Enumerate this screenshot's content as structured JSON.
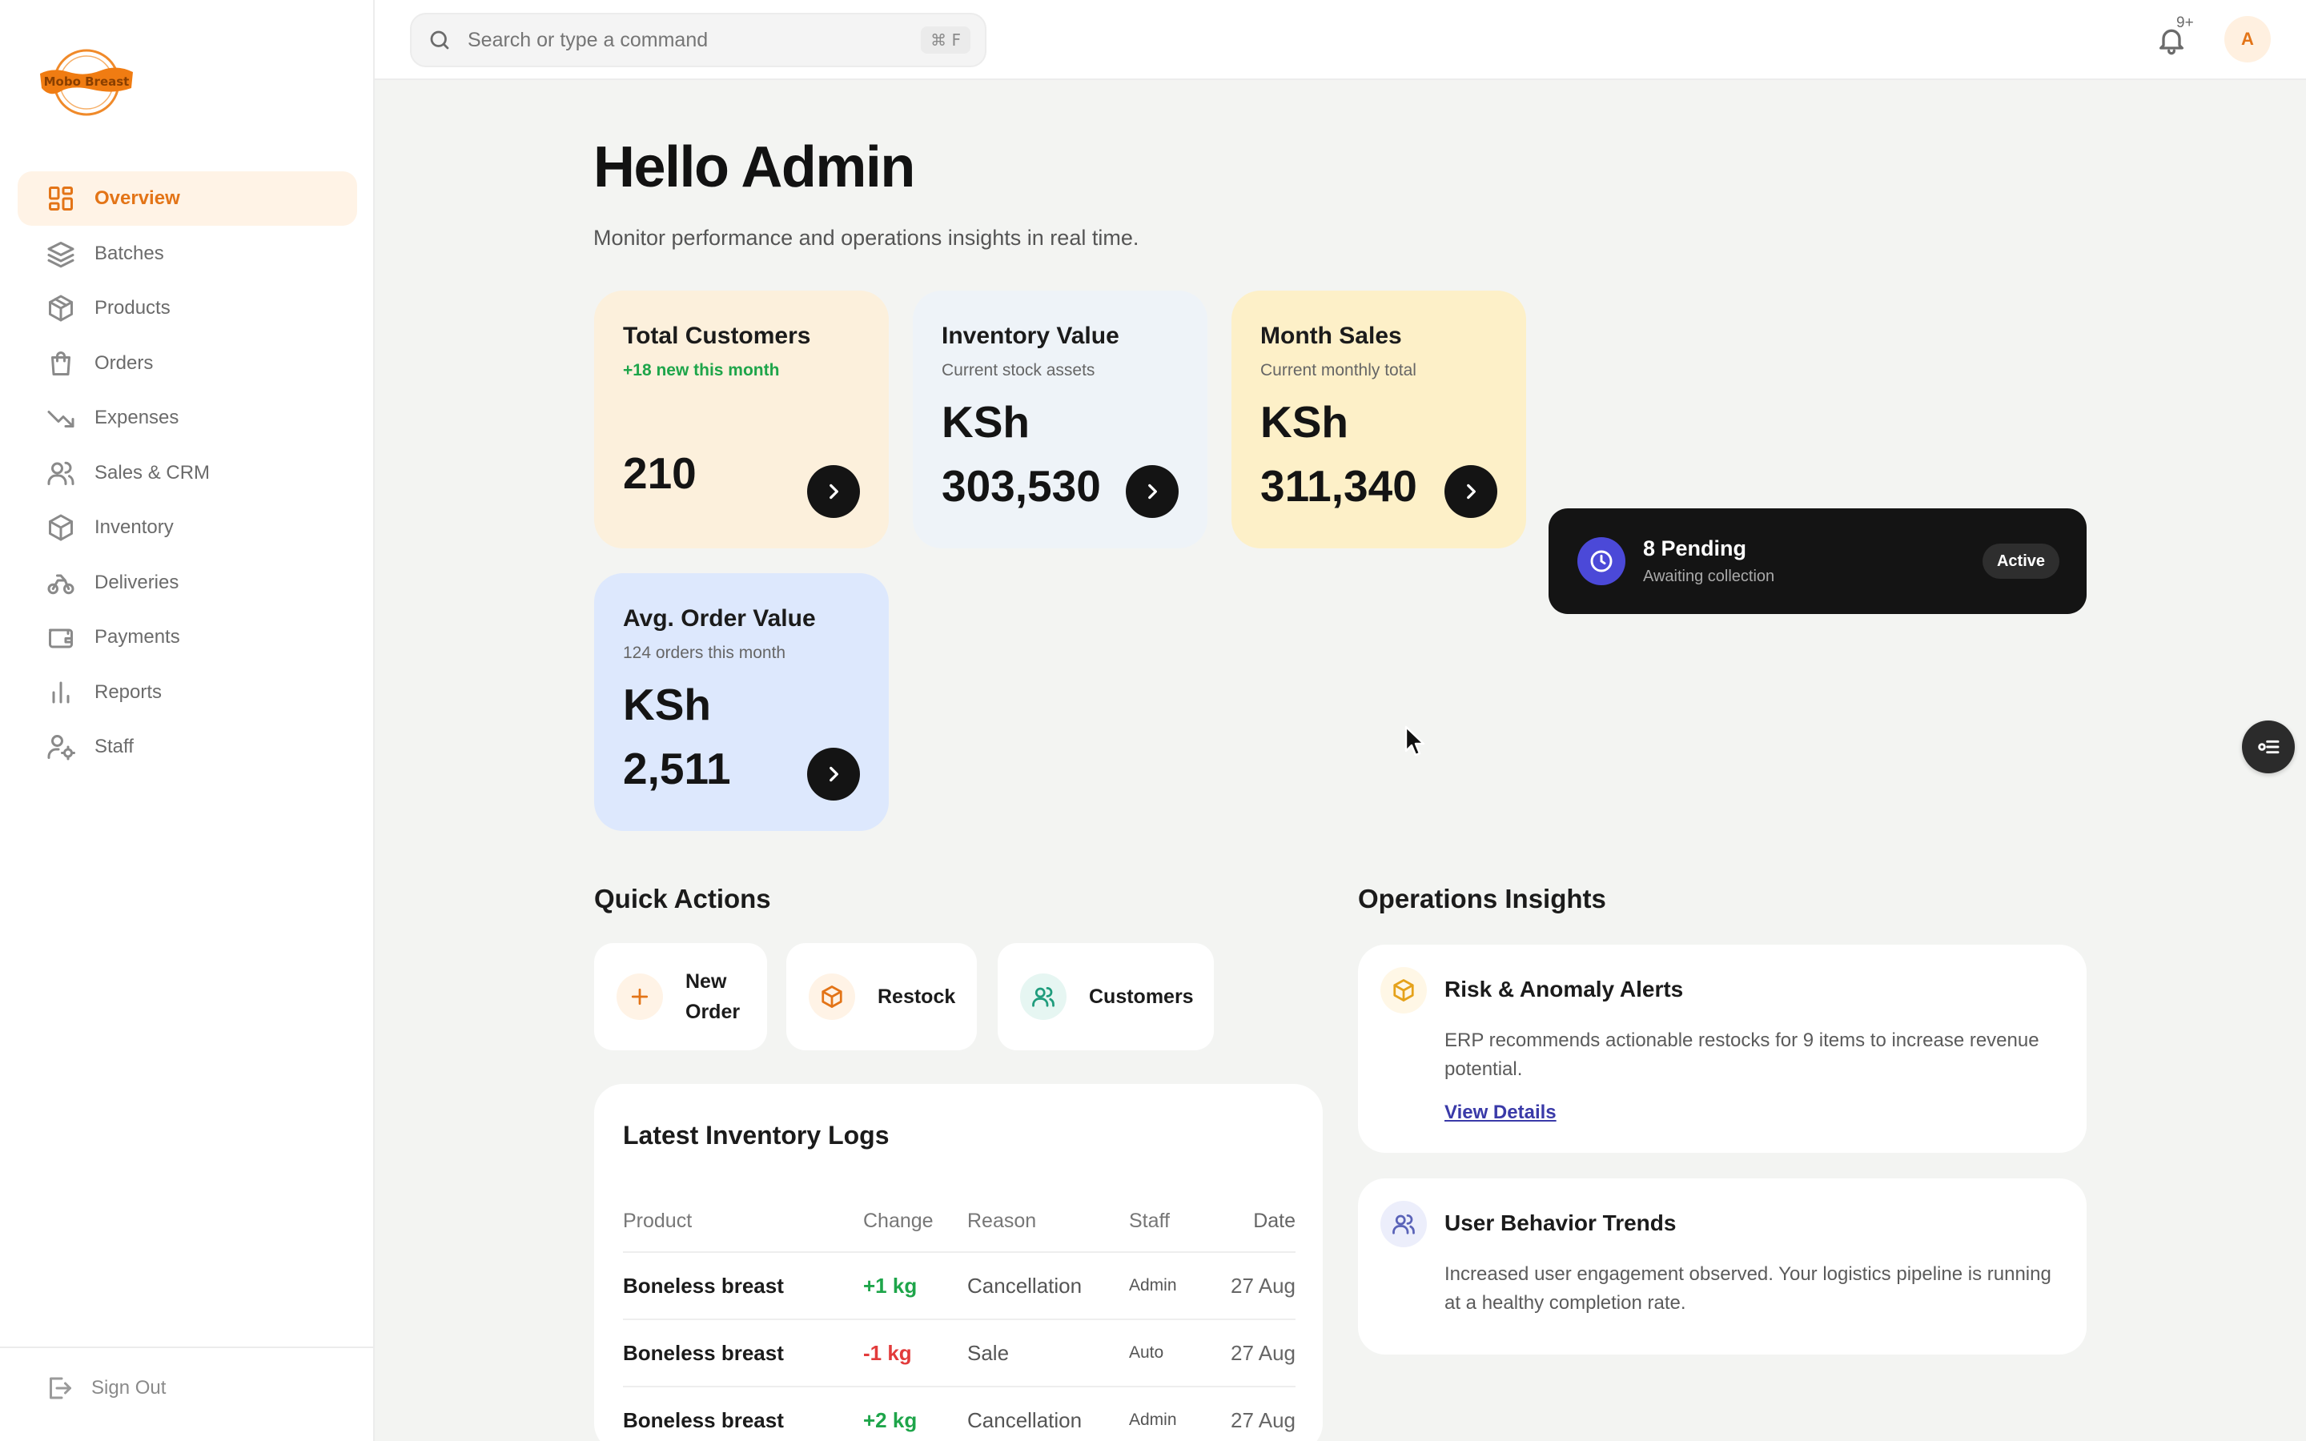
{
  "brand": {
    "logo_text": "Mobo Breast",
    "accent": "#e37417"
  },
  "sidebar": {
    "items": [
      {
        "label": "Overview",
        "icon": "grid-icon",
        "active": true
      },
      {
        "label": "Batches",
        "icon": "layers-icon"
      },
      {
        "label": "Products",
        "icon": "box-icon"
      },
      {
        "label": "Orders",
        "icon": "shopping-bag-icon"
      },
      {
        "label": "Expenses",
        "icon": "trending-down-icon"
      },
      {
        "label": "Sales & CRM",
        "icon": "users-icon"
      },
      {
        "label": "Inventory",
        "icon": "package-icon"
      },
      {
        "label": "Deliveries",
        "icon": "bike-icon"
      },
      {
        "label": "Payments",
        "icon": "wallet-icon"
      },
      {
        "label": "Reports",
        "icon": "bar-chart-icon"
      },
      {
        "label": "Staff",
        "icon": "user-cog-icon"
      }
    ],
    "signout_label": "Sign Out"
  },
  "topbar": {
    "search_placeholder": "Search or type a command",
    "search_shortcut": "⌘ F",
    "notifications_badge": "9+",
    "avatar_initial": "A"
  },
  "header": {
    "greeting": "Hello Admin",
    "subtitle": "Monitor performance and operations insights in real time."
  },
  "stats": [
    {
      "title": "Total Customers",
      "subtitle": "+18 new this month",
      "value": "210",
      "color": "#fcf0dc"
    },
    {
      "title": "Inventory Value",
      "subtitle": "Current stock assets",
      "currency": "KSh",
      "value": "303,530",
      "color": "#eef3f8"
    },
    {
      "title": "Month Sales",
      "subtitle": "Current monthly total",
      "currency": "KSh",
      "value": "311,340",
      "color": "#fdf0c8"
    },
    {
      "title": "Avg. Order Value",
      "subtitle": "124 orders this month",
      "currency": "KSh",
      "value": "2,511",
      "color": "#dde8fd"
    }
  ],
  "pending": {
    "title": "8 Pending",
    "subtitle": "Awaiting collection",
    "badge": "Active"
  },
  "quick_actions": {
    "title": "Quick Actions",
    "items": [
      {
        "label_line1": "New",
        "label_line2": "Order",
        "icon": "plus-icon"
      },
      {
        "label": "Restock",
        "icon": "box-icon"
      },
      {
        "label": "Customers",
        "icon": "users-icon"
      }
    ]
  },
  "inventory_logs": {
    "title": "Latest Inventory Logs",
    "columns": [
      "Product",
      "Change",
      "Reason",
      "Staff",
      "Date"
    ],
    "rows": [
      {
        "product": "Boneless breast",
        "change": "+1 kg",
        "reason": "Cancellation",
        "staff": "Admin",
        "date": "27 Aug"
      },
      {
        "product": "Boneless breast",
        "change": "-1 kg",
        "reason": "Sale",
        "staff": "Auto",
        "date": "27 Aug"
      },
      {
        "product": "Boneless breast",
        "change": "+2 kg",
        "reason": "Cancellation",
        "staff": "Admin",
        "date": "27 Aug"
      }
    ]
  },
  "insights": {
    "title": "Operations Insights",
    "cards": [
      {
        "title": "Risk & Anomaly Alerts",
        "text": "ERP recommends actionable restocks for 9 items to increase revenue potential.",
        "link": "View Details",
        "icon": "box-icon"
      },
      {
        "title": "User Behavior Trends",
        "text": "Increased user engagement observed. Your logistics pipeline is running at a healthy completion rate.",
        "icon": "users-icon"
      }
    ]
  }
}
